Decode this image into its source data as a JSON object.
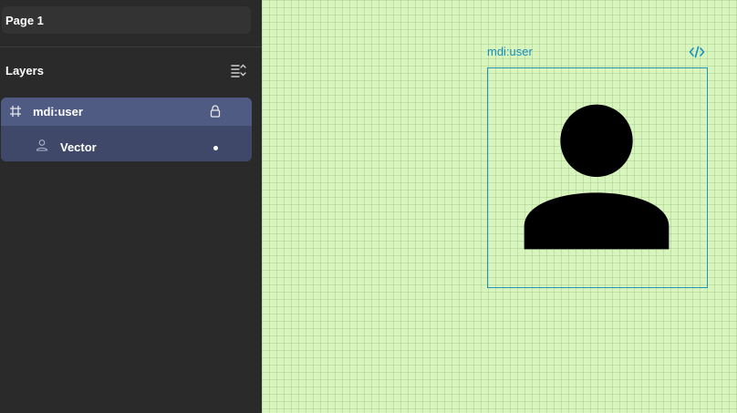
{
  "pages": {
    "current": "Page 1"
  },
  "layers_panel": {
    "title": "Layers",
    "collapse_icon": "collapse-list-icon",
    "items": [
      {
        "label": "mdi:user",
        "icon": "frame-hash-icon",
        "locked": true
      },
      {
        "label": "Vector",
        "icon": "person-icon",
        "indicator": "dot"
      }
    ]
  },
  "canvas": {
    "frame_label": "mdi:user",
    "code_icon": "code-icon",
    "colors": {
      "background": "#d8f5bd",
      "frame_border": "#2394b8",
      "frame_label": "#1b8dc0",
      "vector_fill": "#000000"
    }
  }
}
